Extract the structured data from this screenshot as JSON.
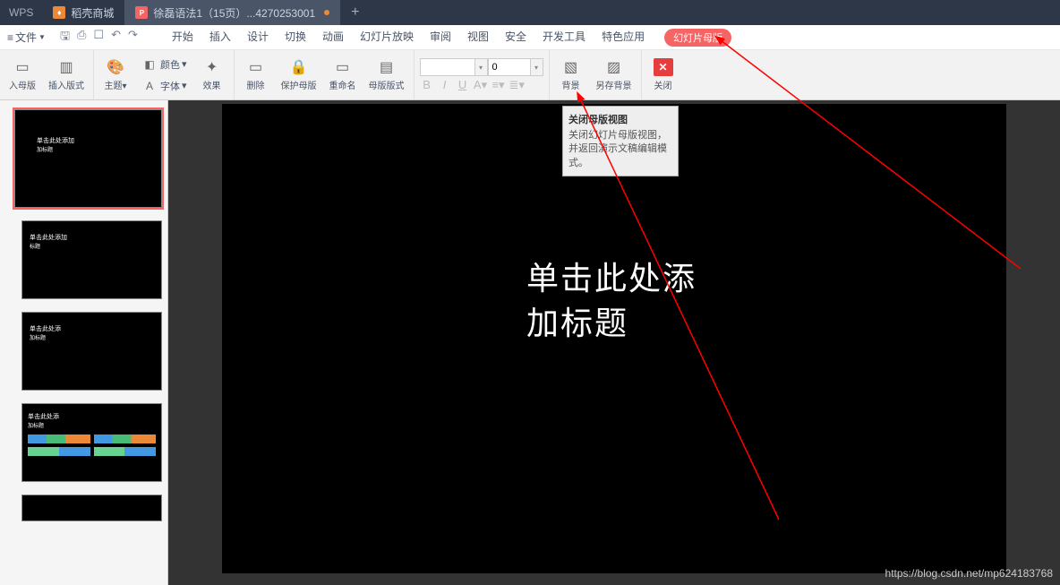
{
  "titlebar": {
    "wps": "WPS",
    "tab1": "稻壳商城",
    "tab2": "徐磊语法1（15页）...4270253001",
    "plus": "+"
  },
  "menubar": {
    "file": "文件",
    "menus": [
      "开始",
      "插入",
      "设计",
      "切换",
      "动画",
      "幻灯片放映",
      "审阅",
      "视图",
      "安全",
      "开发工具",
      "特色应用"
    ],
    "active": "幻灯片母版"
  },
  "ribbon": {
    "insert_master": "入母版",
    "insert_layout": "插入版式",
    "theme": "主题",
    "color": "颜色",
    "font": "字体",
    "effect": "效果",
    "delete": "删除",
    "protect": "保护母版",
    "rename": "重命名",
    "layout": "母版版式",
    "fontsize_val": "0",
    "fontname_val": "",
    "bg": "背景",
    "savebg": "另存背景",
    "close": "关闭"
  },
  "tooltip": {
    "title": "关闭母版视图",
    "body": "关闭幻灯片母版视图，并返回演示文稿编辑模式。"
  },
  "thumbs": {
    "num1": "",
    "slide1_t1": "单击此处添加",
    "slide1_t2": "加标题",
    "slide2_t1": "单击此处添加",
    "slide2_t2": "标题",
    "slide3_t1": "单击此处添",
    "slide3_t2": "加标题",
    "slide4_t1": "单击此处添",
    "slide4_t2": "加标题"
  },
  "slide": {
    "title_l1": "单击此处添",
    "title_l2": "加标题"
  },
  "watermark": "https://blog.csdn.net/mp624183768"
}
